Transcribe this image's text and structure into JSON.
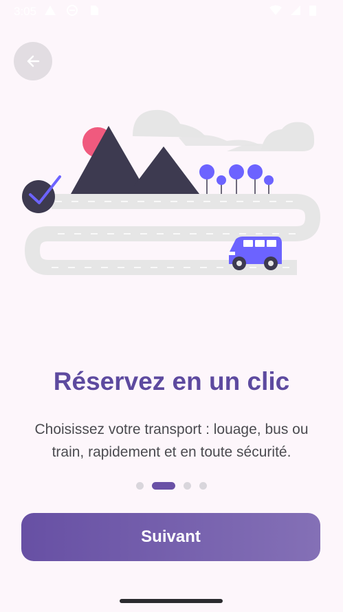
{
  "status_bar": {
    "time": "3:05",
    "icons": [
      "alert-icon",
      "no-disturb-icon",
      "sim-icon",
      "wifi-icon",
      "signal-icon",
      "battery-icon"
    ]
  },
  "header": {
    "back_icon": "arrow-left-icon"
  },
  "illustration": {
    "subject": "road-trip-illustration",
    "colors": {
      "mountain": "#3d3a50",
      "sun": "#f05a7e",
      "accent": "#6c63ff",
      "road": "#e6e6e6",
      "cloud": "#e6e6e6"
    }
  },
  "content": {
    "title": "Réservez en un clic",
    "subtitle": "Choisissez votre transport : louage, bus ou train, rapidement et en toute sécurité."
  },
  "pagination": {
    "total": 4,
    "active_index": 1
  },
  "actions": {
    "next_label": "Suivant"
  },
  "colors": {
    "primary": "#6750a4",
    "background": "#fdf6fb",
    "title": "#5d4a9f",
    "text": "#4b4b50"
  }
}
